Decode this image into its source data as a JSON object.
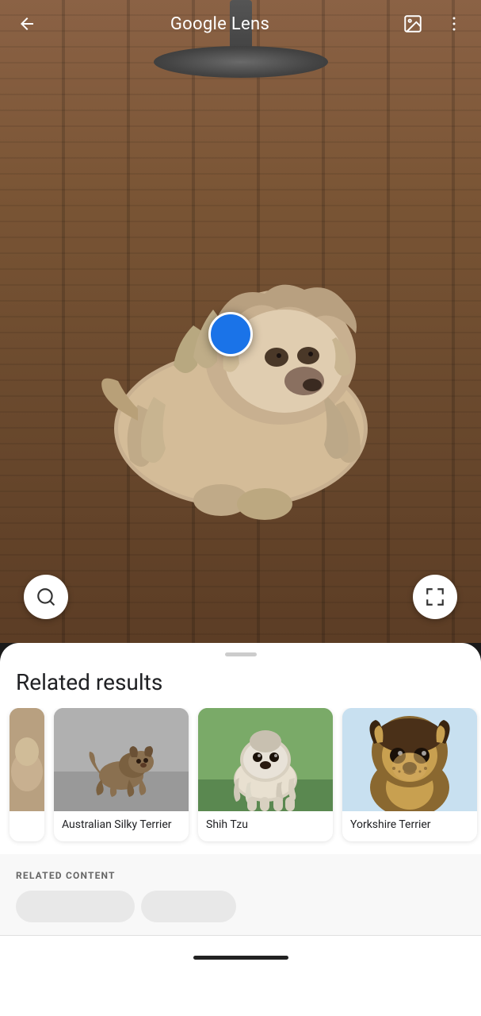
{
  "app": {
    "title": "Google Lens",
    "back_icon": "←",
    "gallery_icon": "⊡",
    "more_icon": "⋮"
  },
  "photo": {
    "description": "Dog lying on wooden deck"
  },
  "actions": {
    "search_icon": "🔍",
    "crop_icon": "⊡"
  },
  "results": {
    "section_title": "Related results",
    "cards": [
      {
        "label": "Australian Silky Terrier",
        "bg_color": "#b0a090",
        "emoji": "🐕"
      },
      {
        "label": "Shih Tzu",
        "bg_color": "#9ab090",
        "emoji": "🐕"
      },
      {
        "label": "Yorkshire Terrier",
        "bg_color": "#c0a878",
        "emoji": "🐕"
      }
    ],
    "related_content_title": "RELATED CONTENT"
  }
}
